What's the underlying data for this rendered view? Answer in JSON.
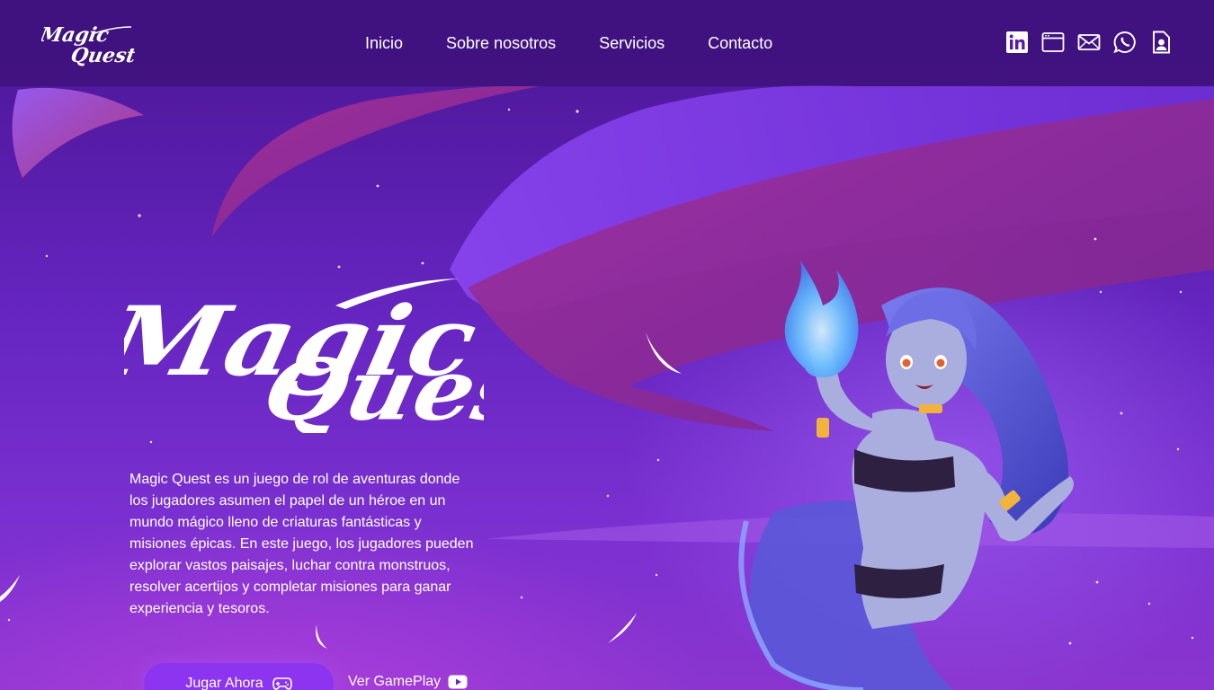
{
  "brand": {
    "logo_line1": "Magic",
    "logo_line2": "Quest"
  },
  "nav": {
    "items": [
      {
        "label": "Inicio"
      },
      {
        "label": "Sobre nosotros"
      },
      {
        "label": "Servicios"
      },
      {
        "label": "Contacto"
      }
    ]
  },
  "social": {
    "icons": [
      "linkedin-icon",
      "browser-window-icon",
      "mail-icon",
      "whatsapp-icon",
      "document-user-icon"
    ]
  },
  "hero": {
    "title_line1": "Magic",
    "title_line2": "Quest",
    "description": "Magic Quest es un juego de rol de aventuras donde los jugadores asumen el papel de un héroe en un mundo mágico lleno de criaturas fantásticas y misiones épicas. En este juego, los jugadores pueden explorar vastos paisajes, luchar contra monstruos, resolver acertijos y completar misiones para ganar experiencia y tesoros.",
    "primary_button": {
      "label": "Jugar Ahora",
      "icon": "gamepad-icon"
    },
    "secondary_button": {
      "label": "Ver GamePlay",
      "icon": "youtube-icon"
    }
  },
  "colors": {
    "background": "#5a1aa8",
    "header": "#3e1278",
    "accent": "#8c34f0",
    "ribbon_magenta": "#8e2a9a",
    "ribbon_violet": "#7a3ae6"
  }
}
